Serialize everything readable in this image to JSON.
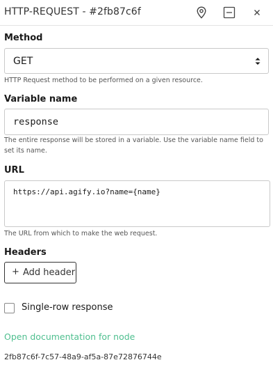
{
  "header": {
    "title": "HTTP-REQUEST - #2fb87c6f",
    "icons": [
      "map-pin-icon",
      "minimize-icon",
      "close-icon"
    ]
  },
  "method": {
    "label": "Method",
    "value": "GET",
    "help": "HTTP Request method to be performed on a given resource."
  },
  "variable": {
    "label": "Variable name",
    "value": "response",
    "help": "The entire response will be stored in a variable. Use the variable name field to set its name."
  },
  "url": {
    "label": "URL",
    "value": "https://api.agify.io?name={name}",
    "help": "The URL from which to make the web request."
  },
  "headers": {
    "label": "Headers",
    "add_plus": "+",
    "add_label": "Add header"
  },
  "single_row": {
    "label": "Single-row response",
    "checked": false
  },
  "footer": {
    "doc_link": "Open documentation for node",
    "node_id": "2fb87c6f-7c57-48a9-af5a-87e72876744e"
  },
  "colors": {
    "link": "#4fbf8f",
    "border": "#c9c9c9",
    "text": "#1a1a1a"
  }
}
